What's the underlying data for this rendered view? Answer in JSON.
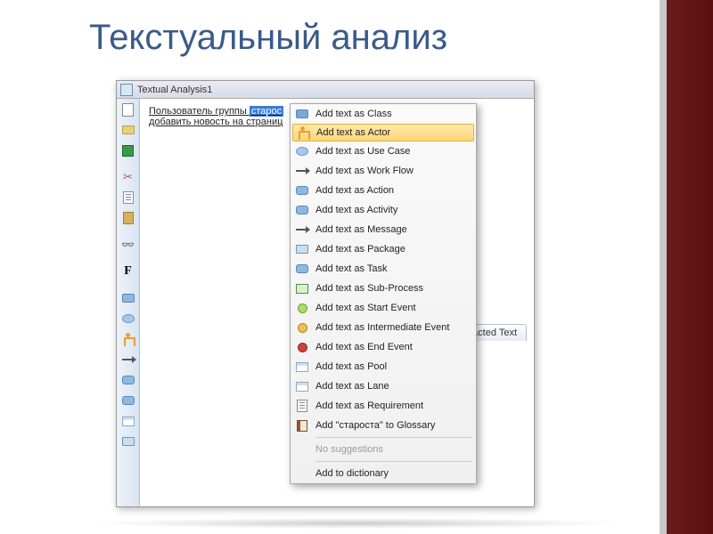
{
  "slide_title": "Текстуальный анализ",
  "window": {
    "title": "Textual Analysis1",
    "text_line1_prefix": "Пользователь группы ",
    "text_line1_selected": "старос",
    "text_line2": "добавить новость на страниц",
    "tab_label": "Extracted Text"
  },
  "toolbar_icons": [
    "new-doc",
    "open-folder",
    "save",
    "blank",
    "cut",
    "copy",
    "paste",
    "blank2",
    "binoculars",
    "blank3",
    "font-bold",
    "blank4",
    "blue-circle",
    "blue-circle2",
    "yellow-actor",
    "arrow-right",
    "blue-rect",
    "blue-rect2",
    "blue-rect3",
    "folder"
  ],
  "menu": {
    "items": [
      {
        "label": "Add text as Class",
        "icon": "class-rect",
        "color": "#7aa8d8"
      },
      {
        "label": "Add text as Actor",
        "icon": "actor",
        "highlighted": true
      },
      {
        "label": "Add text as Use Case",
        "icon": "oval",
        "color": "#a8c8e8"
      },
      {
        "label": "Add text as Work Flow",
        "icon": "arrow"
      },
      {
        "label": "Add text as Action",
        "icon": "rect-round",
        "color": "#8fb8dd"
      },
      {
        "label": "Add text as Activity",
        "icon": "rect-round",
        "color": "#8fb8dd"
      },
      {
        "label": "Add text as Message",
        "icon": "arrow"
      },
      {
        "label": "Add text as Package",
        "icon": "folder-blue"
      },
      {
        "label": "Add text as Task",
        "icon": "rect-round",
        "color": "#8fb8dd"
      },
      {
        "label": "Add text as Sub-Process",
        "icon": "rect-plus"
      },
      {
        "label": "Add text as Start Event",
        "icon": "circle",
        "color": "#a8e060"
      },
      {
        "label": "Add text as Intermediate Event",
        "icon": "circle",
        "color": "#f0c050"
      },
      {
        "label": "Add text as End Event",
        "icon": "circle",
        "color": "#d04040"
      },
      {
        "label": "Add text as Pool",
        "icon": "swim"
      },
      {
        "label": "Add text as Lane",
        "icon": "swim"
      },
      {
        "label": "Add text as Requirement",
        "icon": "doc"
      },
      {
        "label": "Add \"староста\" to Glossary",
        "icon": "book"
      }
    ],
    "no_suggestions": "No suggestions",
    "add_to_dict": "Add to dictionary"
  }
}
